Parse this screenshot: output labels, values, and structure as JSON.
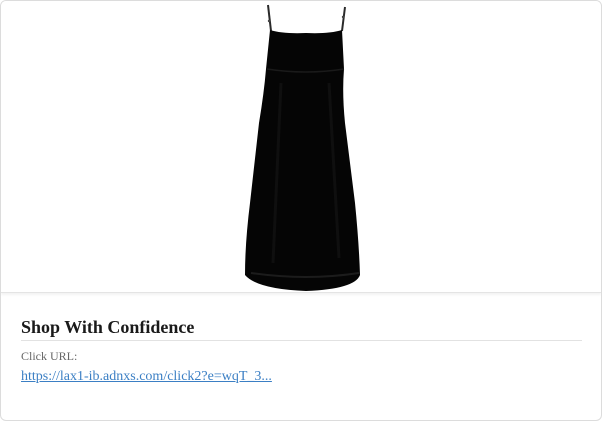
{
  "card": {
    "image_alt": "black slip dress",
    "title": "Shop With Confidence",
    "click_url_label": "Click URL:",
    "click_url": "https://lax1-ib.adnxs.com/click2?e=wqT_3..."
  },
  "colors": {
    "title": "#1a1a1a",
    "label": "#666666",
    "link": "#3b7fc4",
    "dress": "#050505"
  }
}
